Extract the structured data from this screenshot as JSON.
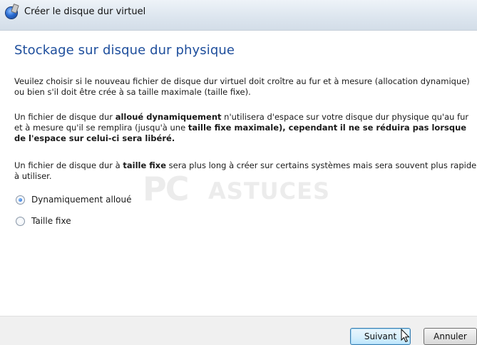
{
  "window": {
    "title": "Créer le disque dur virtuel"
  },
  "page": {
    "heading": "Stockage sur disque dur physique"
  },
  "paragraph1": {
    "text": "Veuilez choisir si le nouveau fichier de disque dur virtuel doit croître au fur et à mesure (allocation dynamique) ou bien s'il doit être crée à sa taille maximale (taille fixe)."
  },
  "paragraph2": {
    "part1": "Un fichier de disque dur ",
    "bold1": "alloué dynamiquement",
    "part2": " n'utilisera d'espace sur votre disque dur physique qu'au fur et à mesure qu'il se remplira (jusqu'à une ",
    "bold2": "taille fixe maximale), cependant",
    "part3": " ",
    "bold3": "il ne se réduira pas lorsque de l'espace sur",
    "part4": " ",
    "bold4": "celui-ci sera libéré."
  },
  "paragraph3": {
    "part1": "Un fichier de disque dur à ",
    "bold1": "taille fixe",
    "part2": " sera plus long à créer sur certains systèmes mais sera souvent plus rapide à utiliser."
  },
  "options": [
    {
      "label": "Dynamiquement alloué",
      "selected": true
    },
    {
      "label": "Taille fixe",
      "selected": false
    }
  ],
  "buttons": {
    "next_label": "Suivant",
    "cancel_label": "Annuler"
  },
  "watermark": {
    "logo_text": "PC ASTUCES"
  },
  "colors": {
    "heading": "#1e4e9c",
    "next_button_border": "#3c7fb1"
  },
  "icons": {
    "window": "virtualbox-disk-icon",
    "cursor": "mouse-pointer-icon"
  }
}
